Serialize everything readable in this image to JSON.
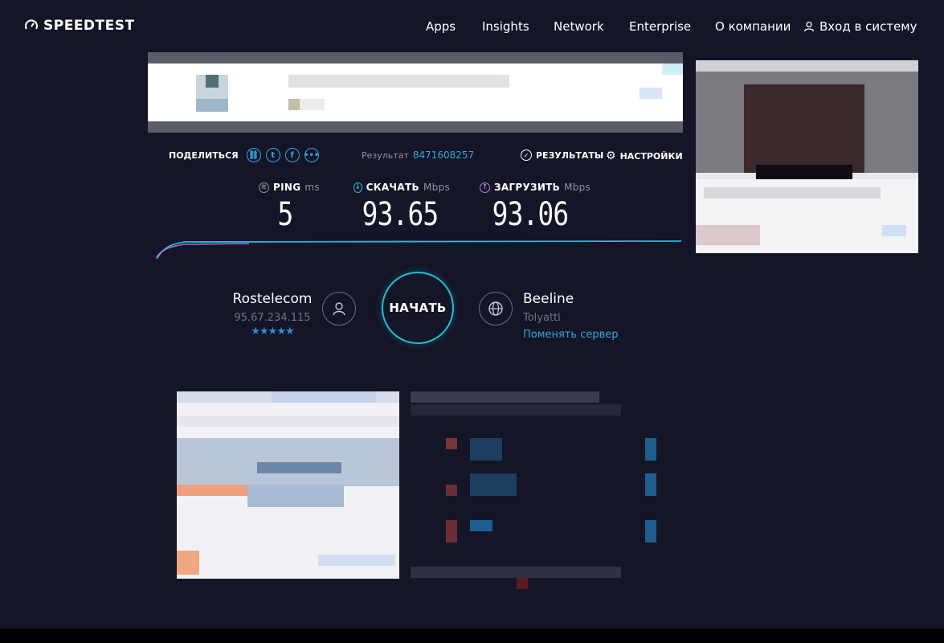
{
  "header": {
    "logo_text": "SPEEDTEST",
    "nav": [
      "Apps",
      "Insights",
      "Network",
      "Enterprise",
      "О компании"
    ],
    "login_label": "Вход в систему"
  },
  "result_bar": {
    "share_label": "ПОДЕЛИТЬСЯ",
    "share_icons": [
      "link-icon",
      "twitter-icon",
      "facebook-icon",
      "more-icon"
    ],
    "result_label": "Результат",
    "result_id": "8471608257",
    "results_label": "РЕЗУЛЬТАТЫ",
    "settings_label": "НАСТРОЙКИ"
  },
  "metrics": {
    "ping": {
      "label": "PING",
      "unit": "ms",
      "value": "5"
    },
    "download": {
      "label": "СКАЧАТЬ",
      "unit": "Mbps",
      "value": "93.65"
    },
    "upload": {
      "label": "ЗАГРУЗИТЬ",
      "unit": "Mbps",
      "value": "93.06"
    }
  },
  "start_label": "НАЧАТЬ",
  "provider": {
    "name": "Rostelecom",
    "ip": "95.67.234.115",
    "rating": "★★★★★"
  },
  "server": {
    "name": "Beeline",
    "city": "Tolyatti",
    "change_label": "Поменять сервер"
  },
  "colors": {
    "background": "#141526",
    "accent": "#1cbfda",
    "link": "#3aa3e3",
    "upload": "#b27ee8"
  }
}
